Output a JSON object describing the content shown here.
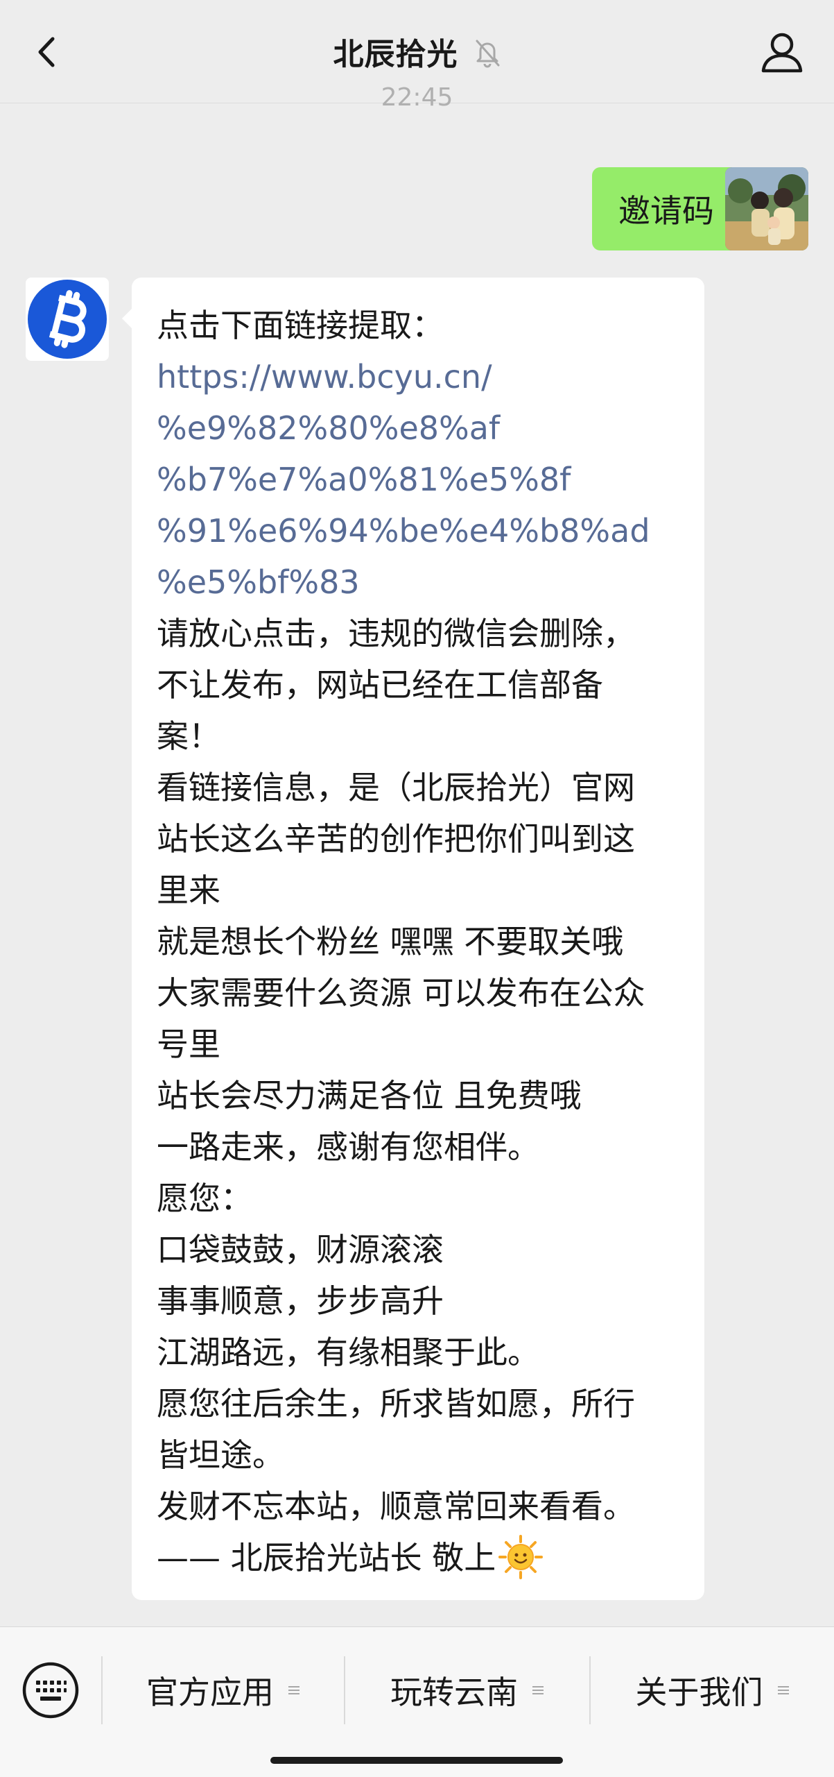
{
  "header": {
    "title": "北辰拾光",
    "back_icon": "chevron-left-icon",
    "mute_icon": "bell-off-icon",
    "profile_icon": "person-icon"
  },
  "chat": {
    "timestamp": "22:45",
    "outgoing_message": "邀请码",
    "incoming_message": {
      "intro": "点击下面链接提取：",
      "link_lines": [
        "https://www.bcyu.cn/",
        "%e9%82%80%e8%af",
        "%b7%e7%a0%81%e5%8f",
        "%91%e6%94%be%e4%b8%ad",
        "%e5%bf%83"
      ],
      "body_lines": [
        "请放心点击，违规的微信会删除，",
        "不让发布，网站已经在工信部备",
        "案！",
        "看链接信息，是（北辰拾光）官网",
        "站长这么辛苦的创作把你们叫到这",
        "里来",
        "就是想长个粉丝  嘿嘿 不要取关哦",
        "大家需要什么资源 可以发布在公众",
        "号里",
        "站长会尽力满足各位 且免费哦",
        "一路走来，感谢有您相伴。",
        "愿您：",
        "口袋鼓鼓，财源滚滚",
        "事事顺意，步步高升",
        "江湖路远，有缘相聚于此。",
        "愿您往后余生，所求皆如愿，所行",
        "皆坦途。",
        "发财不忘本站，顺意常回来看看。"
      ],
      "signature": "—— 北辰拾光站长 敬上",
      "emoji": "sun-with-face-icon"
    }
  },
  "menu": {
    "keyboard_icon": "keyboard-icon",
    "items": [
      {
        "label": "官方应用"
      },
      {
        "label": "玩转云南"
      },
      {
        "label": "关于我们"
      }
    ],
    "menu_icon": "list-menu-icon"
  },
  "colors": {
    "background": "#ededed",
    "outgoing_bubble": "#95ec69",
    "incoming_bubble": "#ffffff",
    "link": "#576b95",
    "brand_avatar": "#1a58d8"
  }
}
